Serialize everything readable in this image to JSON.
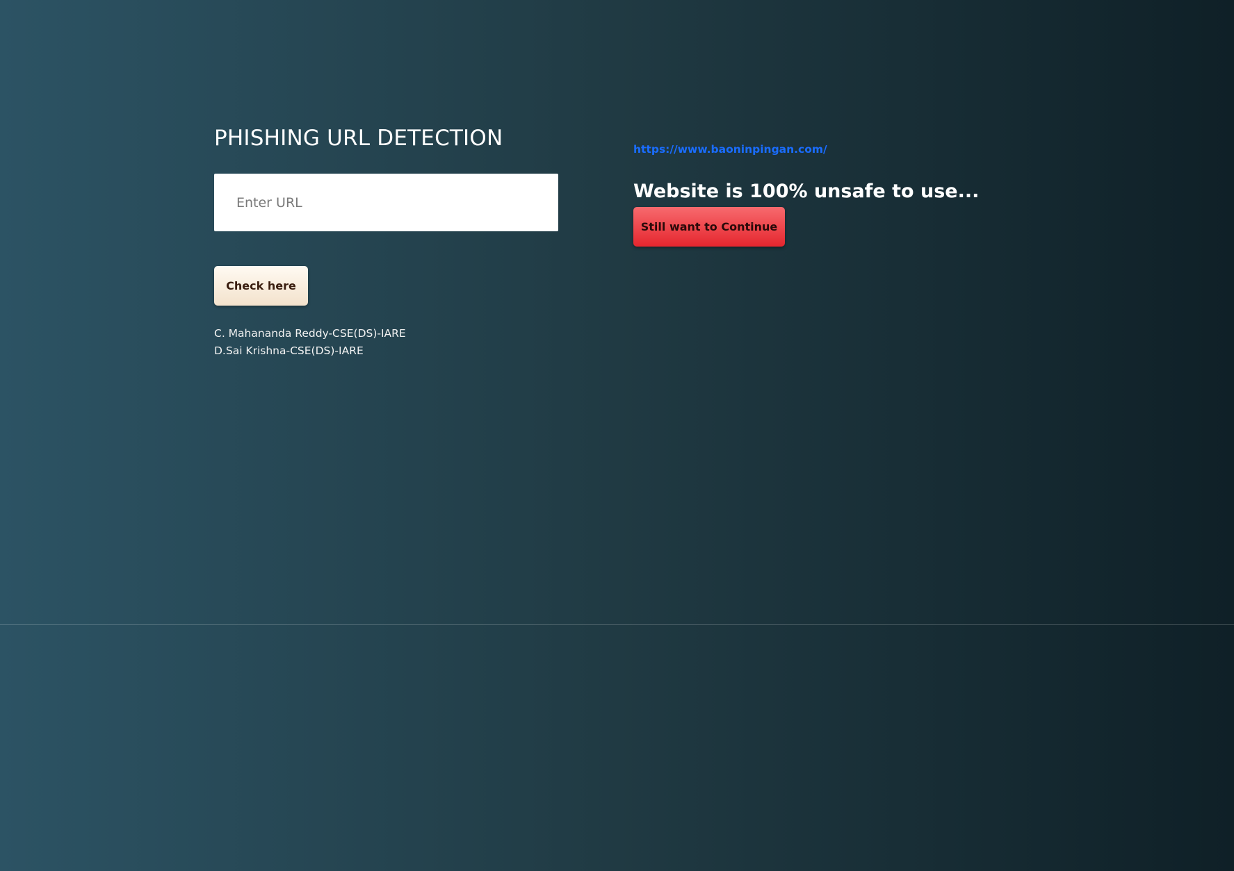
{
  "header": {
    "title": "PHISHING URL DETECTION"
  },
  "form": {
    "url_placeholder": "Enter URL",
    "url_value": "",
    "check_button_label": "Check here"
  },
  "credits": [
    "C. Mahananda Reddy-CSE(DS)-IARE",
    "D.Sai Krishna-CSE(DS)-IARE"
  ],
  "result": {
    "url": "https://www.baoninpingan.com/",
    "message": "Website is 100% unsafe to use...",
    "continue_button_label": "Still want to Continue"
  },
  "colors": {
    "background_gradient": [
      "#2c5364",
      "#203a43",
      "#0f2027"
    ],
    "link": "#1a6dff",
    "check_button": "#fff5e8",
    "continue_button": "#ee474d"
  }
}
